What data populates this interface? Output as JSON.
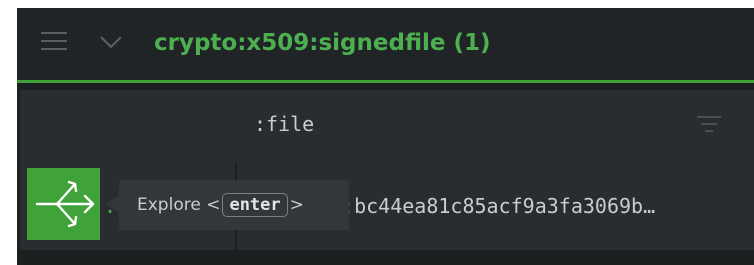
{
  "header": {
    "menu_icon": "hamburger-icon",
    "collapse_icon": "chevron-down-icon",
    "title": "crypto:x509:signedfile (1)"
  },
  "table": {
    "columns": [
      {
        "label": ":file",
        "filter_icon": "filter-icon"
      }
    ],
    "rows": [
      {
        "explore_icon": "explore-icon",
        "colon": ":",
        "value": "5:bc44ea81c85acf9a3fa3069b…"
      }
    ]
  },
  "tooltip": {
    "prefix": "Explore <",
    "key": "enter",
    "suffix": ">"
  },
  "colors": {
    "accent": "#3fa33a",
    "title": "#4caf50",
    "background": "#1d2021",
    "row": "#2a2d30",
    "text": "#c9ccd1"
  }
}
